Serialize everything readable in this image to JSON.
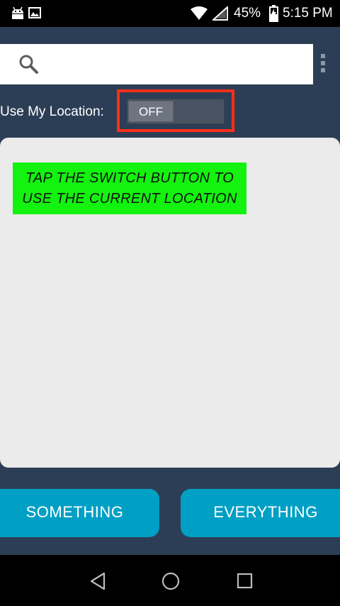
{
  "status_bar": {
    "battery_percent": "45%",
    "time": "5:15 PM",
    "icons": [
      "android-icon",
      "image-icon",
      "wifi-icon",
      "signal-icon",
      "battery-charging-icon"
    ]
  },
  "search": {
    "value": "",
    "icon": "search-icon"
  },
  "location": {
    "label": "Use My Location:",
    "switch_state": "OFF"
  },
  "hint": {
    "line1": "TAP THE SWITCH BUTTON TO",
    "line2": "USE THE CURRENT LOCATION"
  },
  "buttons": {
    "something": "SOMETHING",
    "everything": "EVERYTHING"
  },
  "colors": {
    "background": "#2c3e55",
    "accent_button": "#009fc4",
    "hint_green": "#14f20f",
    "highlight_red": "#ff2e16"
  },
  "nav_bar": {
    "icons": [
      "back-icon",
      "home-icon",
      "recents-icon"
    ]
  }
}
